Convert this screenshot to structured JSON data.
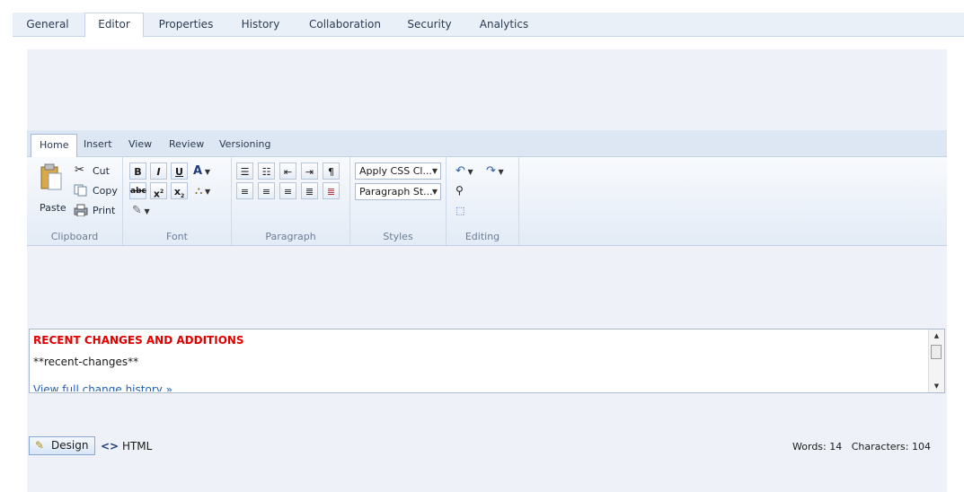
{
  "top_tabs": [
    {
      "label": "General"
    },
    {
      "label": "Editor"
    },
    {
      "label": "Properties"
    },
    {
      "label": "History"
    },
    {
      "label": "Collaboration"
    },
    {
      "label": "Security"
    },
    {
      "label": "Analytics"
    }
  ],
  "active_top_tab": "Editor",
  "ribbon": {
    "tabs": [
      {
        "label": "Home"
      },
      {
        "label": "Insert"
      },
      {
        "label": "View"
      },
      {
        "label": "Review"
      },
      {
        "label": "Versioning"
      }
    ],
    "clipboard": {
      "label": "Clipboard",
      "paste": "Paste",
      "cut": "Cut",
      "copy": "Copy",
      "print": "Print"
    },
    "font": {
      "label": "Font"
    },
    "paragraph": {
      "label": "Paragraph"
    },
    "styles": {
      "label": "Styles",
      "css_class": "Apply CSS Cl...",
      "paragraph_style": "Paragraph St..."
    },
    "editing": {
      "label": "Editing"
    }
  },
  "content": {
    "heading": "RECENT CHANGES AND ADDITIONS",
    "paragraph": "**recent-changes**",
    "link": "View full change history »"
  },
  "bottom": {
    "design": "Design",
    "html": "HTML",
    "words": "Words: 14",
    "characters": "Characters: 104"
  },
  "colors": {
    "accent": "#e00000",
    "link": "#1f5fb0",
    "ribbon": "#dde7f3",
    "panel": "#eef2f8"
  }
}
